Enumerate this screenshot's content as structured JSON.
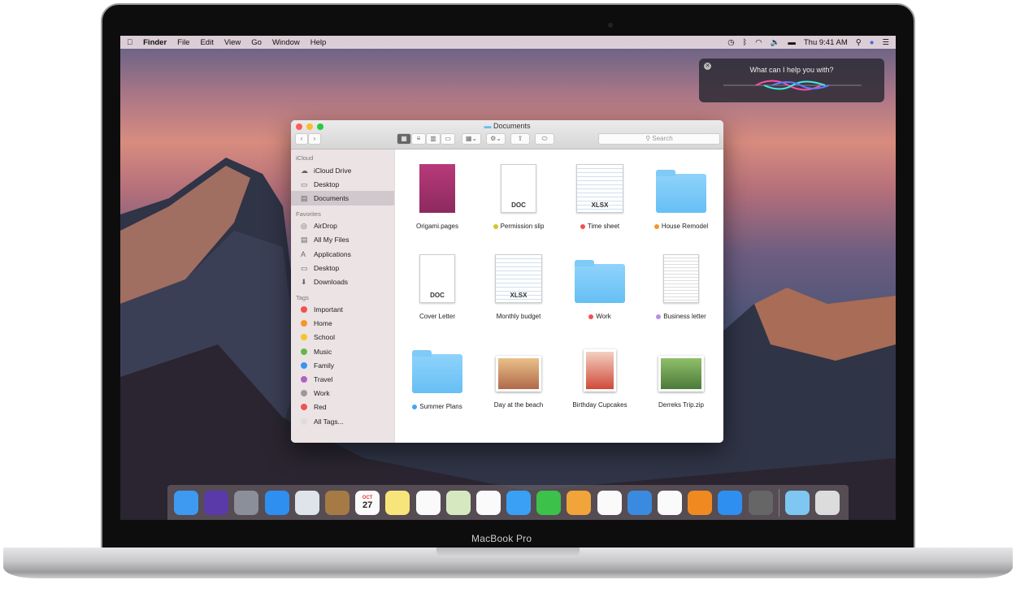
{
  "menubar": {
    "apple": "",
    "app": "Finder",
    "items": [
      "File",
      "Edit",
      "View",
      "Go",
      "Window",
      "Help"
    ],
    "clock": "Thu 9:41 AM",
    "status_icons": [
      "time-machine-icon",
      "bluetooth-icon",
      "wifi-icon",
      "volume-icon",
      "battery-icon",
      "spotlight-icon",
      "siri-icon",
      "notification-center-icon"
    ]
  },
  "siri": {
    "prompt": "What can I help you with?"
  },
  "finder": {
    "title": "Documents",
    "search_placeholder": "Search",
    "sidebar": {
      "sections": [
        {
          "header": "iCloud",
          "items": [
            "iCloud Drive",
            "Desktop",
            "Documents"
          ]
        },
        {
          "header": "Favorites",
          "items": [
            "AirDrop",
            "All My Files",
            "Applications",
            "Desktop",
            "Downloads"
          ]
        },
        {
          "header": "Tags",
          "items": [
            "Important",
            "Home",
            "School",
            "Music",
            "Family",
            "Travel",
            "Work",
            "Red",
            "All Tags..."
          ]
        }
      ],
      "selected": "Documents",
      "tag_colors": [
        "#f0524f",
        "#f5962c",
        "#f5c52a",
        "#62b946",
        "#3b93f0",
        "#b05ec8",
        "#999999",
        "#f0524f",
        "#dddddd"
      ]
    },
    "files": [
      {
        "name": "Origami.pages",
        "kind": "pages",
        "tag": null
      },
      {
        "name": "Permission slip",
        "kind": "DOC",
        "tag": "#d4c627"
      },
      {
        "name": "Time sheet",
        "kind": "XLSX",
        "tag": "#f0524f"
      },
      {
        "name": "House Remodel",
        "kind": "folder",
        "tag": "#f5962c"
      },
      {
        "name": "Cover Letter",
        "kind": "DOC",
        "tag": null
      },
      {
        "name": "Monthly budget",
        "kind": "XLSX",
        "tag": null
      },
      {
        "name": "Work",
        "kind": "folder",
        "tag": "#f0524f"
      },
      {
        "name": "Business letter",
        "kind": "text",
        "tag": "#b88ee8"
      },
      {
        "name": "Summer Plans",
        "kind": "folder",
        "tag": "#4aa3f0"
      },
      {
        "name": "Day at the beach",
        "kind": "photo",
        "tag": null
      },
      {
        "name": "Birthday Cupcakes",
        "kind": "photo",
        "tag": null
      },
      {
        "name": "Derreks Trip.zip",
        "kind": "photo",
        "tag": null
      }
    ]
  },
  "dock": {
    "apps": [
      "Finder",
      "Siri",
      "Launchpad",
      "Safari",
      "Mail",
      "Contacts",
      "Calendar",
      "Notes",
      "Reminders",
      "Maps",
      "Photos",
      "Messages",
      "FaceTime",
      "Pages",
      "Numbers",
      "Keynote",
      "iTunes",
      "iBooks",
      "App Store",
      "System Preferences",
      "Downloads",
      "Trash"
    ],
    "calendar": {
      "month": "OCT",
      "day": "27"
    }
  },
  "laptop": {
    "label": "MacBook Pro"
  }
}
